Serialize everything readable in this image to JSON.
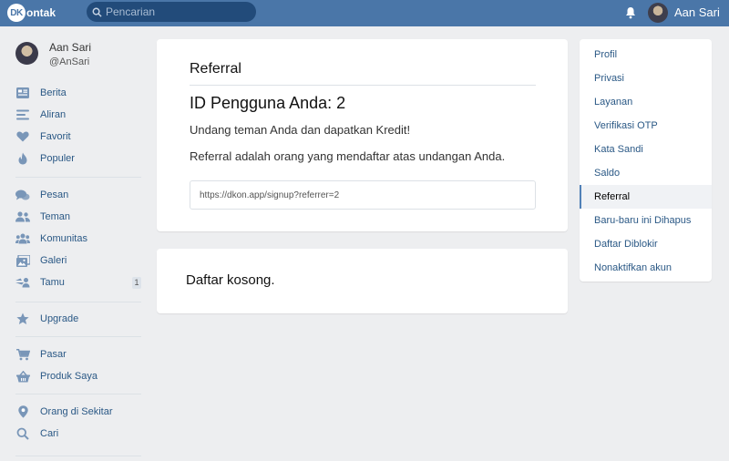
{
  "topbar": {
    "logo_badge": "DK",
    "logo_text": "ontak",
    "search_placeholder": "Pencarian",
    "username": "Aan Sari",
    "icons": {
      "search": "search-icon",
      "notifications": "bell-icon"
    }
  },
  "profile": {
    "name": "Aan Sari",
    "handle": "@AnSari"
  },
  "sidebar": {
    "items": [
      {
        "label": "Berita",
        "icon": "news-icon"
      },
      {
        "label": "Aliran",
        "icon": "list-icon"
      },
      {
        "label": "Favorit",
        "icon": "heart-icon"
      },
      {
        "label": "Populer",
        "icon": "fire-icon"
      },
      {
        "label": "Pesan",
        "icon": "chat-icon"
      },
      {
        "label": "Teman",
        "icon": "friends-icon"
      },
      {
        "label": "Komunitas",
        "icon": "community-icon"
      },
      {
        "label": "Galeri",
        "icon": "gallery-icon"
      },
      {
        "label": "Tamu",
        "icon": "guest-icon",
        "badge": "1"
      },
      {
        "label": "Upgrade",
        "icon": "star-icon"
      },
      {
        "label": "Pasar",
        "icon": "cart-icon"
      },
      {
        "label": "Produk Saya",
        "icon": "basket-icon"
      },
      {
        "label": "Orang di Sekitar",
        "icon": "location-pin-icon"
      },
      {
        "label": "Cari",
        "icon": "search-icon"
      }
    ]
  },
  "referral": {
    "title": "Referral",
    "user_id": "ID Pengguna Anda: 2",
    "invite_text": "Undang teman Anda dan dapatkan Kredit!",
    "description": "Referral adalah orang yang mendaftar atas undangan Anda.",
    "link": "https://dkon.app/signup?referrer=2"
  },
  "list": {
    "empty_text": "Daftar kosong."
  },
  "settings_menu": {
    "active": "Referral",
    "items": [
      "Profil",
      "Privasi",
      "Layanan",
      "Verifikasi OTP",
      "Kata Sandi",
      "Saldo",
      "Referral",
      "Baru-baru ini Dihapus",
      "Daftar Diblokir",
      "Nonaktifkan akun"
    ]
  },
  "colors": {
    "brand": "#4a76a8",
    "link": "#2a5885",
    "icon": "#7996b8",
    "background": "#edeef0"
  }
}
